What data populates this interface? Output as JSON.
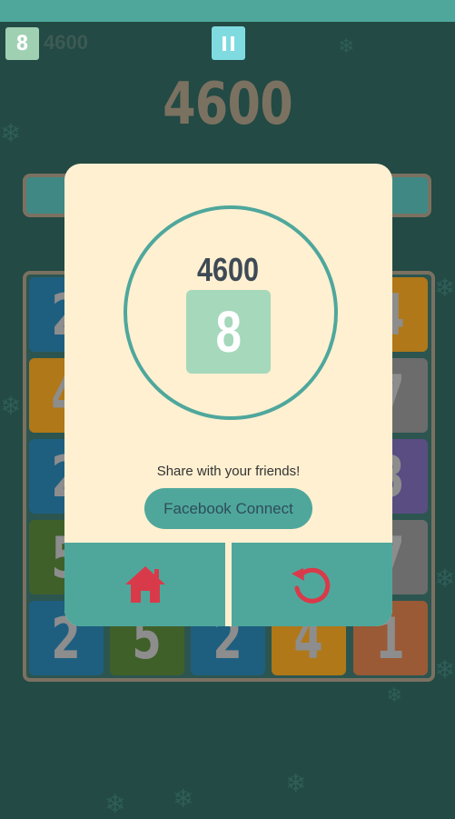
{
  "hud": {
    "level_tile": "8",
    "score": "4600",
    "pause_icon": "pause-icon"
  },
  "main_score": "4600",
  "board": {
    "visible_tiles": [
      {
        "value": "2",
        "color": "#1e5f80"
      },
      {
        "value": "5",
        "color": "#40602a"
      },
      {
        "value": "2",
        "color": "#1e5f80"
      },
      {
        "value": "4",
        "color": "#b07818"
      },
      {
        "value": "1",
        "color": "#9a5a36"
      }
    ],
    "left_column": [
      {
        "value": "2",
        "color": "#1e5f80"
      },
      {
        "value": "4",
        "color": "#b07818"
      },
      {
        "value": "2",
        "color": "#1e5f80"
      },
      {
        "value": "5",
        "color": "#40602a"
      }
    ],
    "right_column": [
      {
        "value": "4",
        "color": "#b07818"
      },
      {
        "value": "7",
        "color": "#6c6c6c"
      },
      {
        "value": "3",
        "color": "#5a4d82"
      },
      {
        "value": "7",
        "color": "#6c6c6c"
      }
    ]
  },
  "modal": {
    "score": "4600",
    "tile_value": "8",
    "share_text": "Share with your friends!",
    "facebook_button": "Facebook Connect",
    "home_icon": "home-icon",
    "restart_icon": "restart-icon"
  },
  "colors": {
    "accent": "#4fa79c",
    "modal_bg": "#fff0d1",
    "icon_red": "#d93a4a"
  }
}
